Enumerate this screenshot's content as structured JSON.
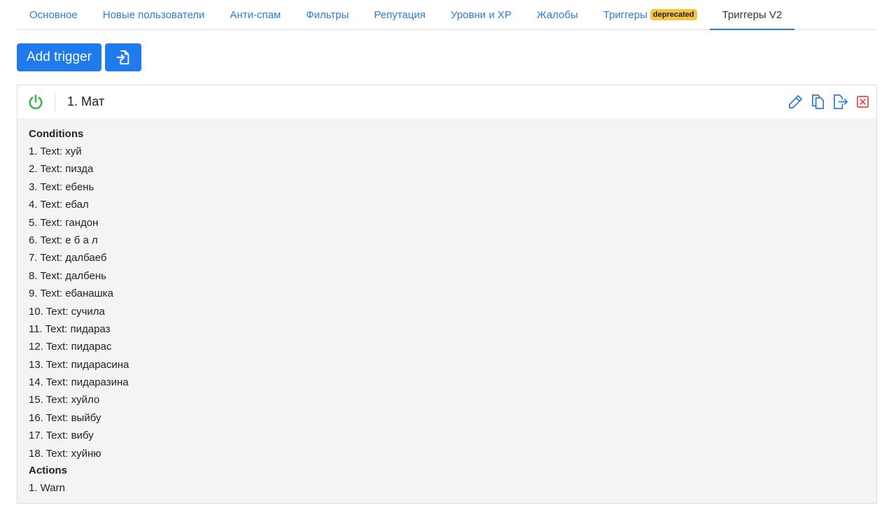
{
  "tabs": [
    {
      "label": "Основное"
    },
    {
      "label": "Новые пользователи"
    },
    {
      "label": "Анти-спам"
    },
    {
      "label": "Фильтры"
    },
    {
      "label": "Репутация"
    },
    {
      "label": "Уровни и XP"
    },
    {
      "label": "Жалобы"
    },
    {
      "label": "Триггеры",
      "badge": "deprecated"
    },
    {
      "label": "Триггеры V2"
    }
  ],
  "toolbar": {
    "add_trigger_label": "Add trigger",
    "import_icon": "file-import-icon"
  },
  "trigger": {
    "title": "1. Мат",
    "enabled": true,
    "icons": [
      "power-icon",
      "pencil-icon",
      "copy-icon",
      "export-icon",
      "delete-icon"
    ],
    "conditions_title": "Conditions",
    "conditions": [
      "1. Text: хуй",
      "2. Text: пизда",
      "3. Text: ебень",
      "4. Text: ебал",
      "5. Text: гандон",
      "6. Text: е б а л",
      "7. Text: далбаеб",
      "8. Text: далбень",
      "9. Text: ебанашка",
      "10. Text: сучила",
      "11. Text: пидараз",
      "12. Text: пидарас",
      "13. Text: пидарасина",
      "14. Text: пидаразина",
      "15. Text: хуйло",
      "16. Text: выйбу",
      "17. Text: вибу",
      "18. Text: хуйню"
    ],
    "actions_title": "Actions",
    "actions": [
      "1. Warn"
    ]
  },
  "colors": {
    "accent": "#1f7aec",
    "link": "#2f7bd8",
    "power_on": "#3bb54a",
    "delete": "#e5484d",
    "badge": "#f5c242"
  }
}
